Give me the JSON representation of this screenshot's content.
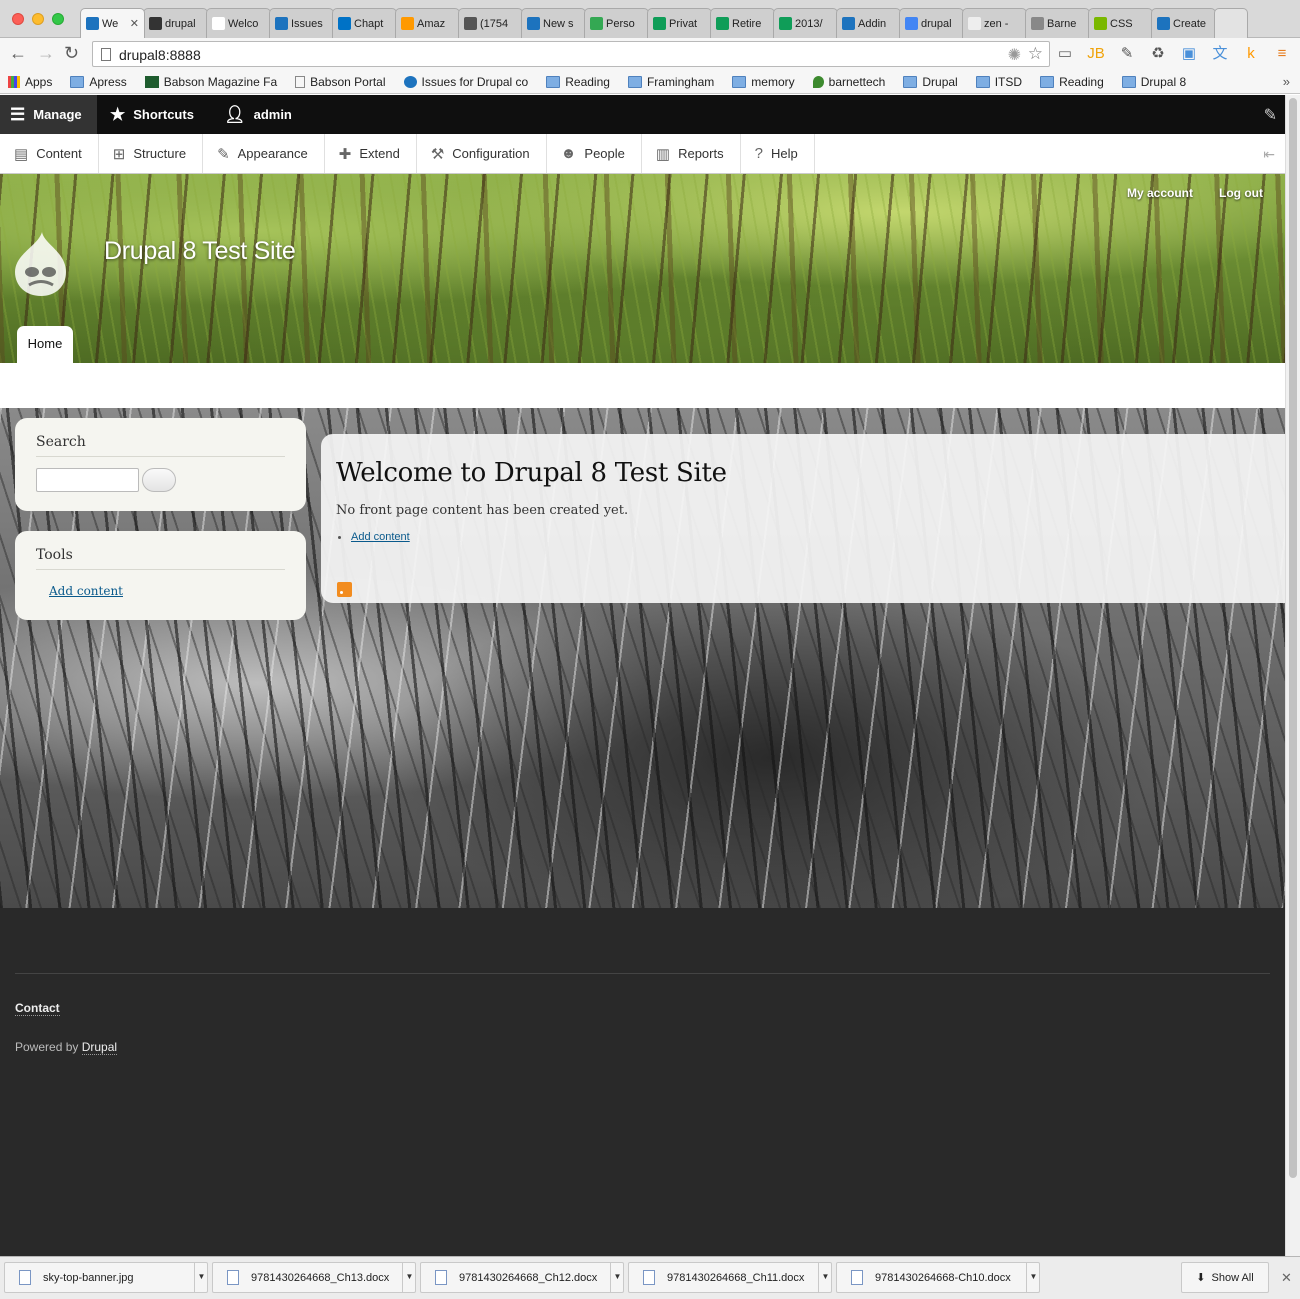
{
  "browser": {
    "tabs": [
      {
        "title": "We",
        "color": "#1d73be",
        "active": true
      },
      {
        "title": "drupal",
        "color": "#333333"
      },
      {
        "title": "Welco",
        "color": "#ffffff"
      },
      {
        "title": "Issues",
        "color": "#1d73be"
      },
      {
        "title": "Chapt",
        "color": "#0072c6"
      },
      {
        "title": "Amaz",
        "color": "#ff9900"
      },
      {
        "title": "(1754",
        "color": "#555555"
      },
      {
        "title": "New s",
        "color": "#1d73be"
      },
      {
        "title": "Perso",
        "color": "#34a853"
      },
      {
        "title": "Privat",
        "color": "#0f9d58"
      },
      {
        "title": "Retire",
        "color": "#0f9d58"
      },
      {
        "title": "2013/",
        "color": "#0f9d58"
      },
      {
        "title": "Addin",
        "color": "#1d73be"
      },
      {
        "title": "drupal",
        "color": "#4285f4"
      },
      {
        "title": "zen -",
        "color": "#eeeeee"
      },
      {
        "title": "Barne",
        "color": "#888888"
      },
      {
        "title": "CSS",
        "color": "#7ab800"
      },
      {
        "title": "Create",
        "color": "#1d73be"
      }
    ],
    "tab_close": "✕",
    "url": "drupal8:8888",
    "nav": {
      "back": "←",
      "forward": "→",
      "reload": "↻",
      "star": "☆",
      "gear": "✺"
    },
    "extensions": [
      {
        "icon": "cast-icon",
        "glyph": "▭",
        "color": "#666666"
      },
      {
        "icon": "jetbrains-icon",
        "glyph": "JB",
        "color": "#f0a30a"
      },
      {
        "icon": "eyedropper-icon",
        "glyph": "✎",
        "color": "#555555"
      },
      {
        "icon": "recycle-icon",
        "glyph": "♻",
        "color": "#555555"
      },
      {
        "icon": "window-icon",
        "glyph": "▣",
        "color": "#4a90d9"
      },
      {
        "icon": "translate-icon",
        "glyph": "文",
        "color": "#4a90d9"
      },
      {
        "icon": "k-icon",
        "glyph": "k",
        "color": "#ff9900"
      },
      {
        "icon": "menu-icon",
        "glyph": "≡",
        "color": "#e67e22"
      }
    ],
    "bookmarks": [
      {
        "label": "Apps",
        "type": "apps"
      },
      {
        "label": "Apress",
        "type": "folder"
      },
      {
        "label": "Babson Magazine Fa",
        "type": "b"
      },
      {
        "label": "Babson Portal",
        "type": "page"
      },
      {
        "label": "Issues for Drupal co",
        "type": "drupal"
      },
      {
        "label": "Reading",
        "type": "folder"
      },
      {
        "label": "Framingham",
        "type": "folder"
      },
      {
        "label": "memory",
        "type": "folder"
      },
      {
        "label": "barnettech",
        "type": "leaf"
      },
      {
        "label": "Drupal",
        "type": "folder"
      },
      {
        "label": "ITSD",
        "type": "folder"
      },
      {
        "label": "Reading",
        "type": "folder"
      },
      {
        "label": "Drupal 8",
        "type": "folder"
      }
    ],
    "bookmarks_more": "»"
  },
  "admin": {
    "manage": "Manage",
    "shortcuts": "Shortcuts",
    "user": "admin",
    "tray": [
      {
        "label": "Content",
        "icon": "content-icon",
        "glyph": "▤"
      },
      {
        "label": "Structure",
        "icon": "structure-icon",
        "glyph": "⊞"
      },
      {
        "label": "Appearance",
        "icon": "appearance-icon",
        "glyph": "✎"
      },
      {
        "label": "Extend",
        "icon": "extend-icon",
        "glyph": "✚"
      },
      {
        "label": "Configuration",
        "icon": "configuration-icon",
        "glyph": "⚒"
      },
      {
        "label": "People",
        "icon": "people-icon",
        "glyph": "☻"
      },
      {
        "label": "Reports",
        "icon": "reports-icon",
        "glyph": "▥"
      },
      {
        "label": "Help",
        "icon": "help-icon",
        "glyph": "?"
      }
    ]
  },
  "site": {
    "name": "Drupal 8 Test Site",
    "my_account": "My account",
    "log_out": "Log out",
    "home_tab": "Home"
  },
  "sidebar": {
    "search_title": "Search",
    "tools_title": "Tools",
    "tools_link": "Add content"
  },
  "main": {
    "title": "Welcome to Drupal 8 Test Site",
    "message": "No front page content has been created yet.",
    "link": "Add content"
  },
  "footer": {
    "contact": "Contact",
    "powered_prefix": "Powered by",
    "powered_link": "Drupal"
  },
  "downloads": {
    "items": [
      {
        "name": "sky-top-banner.jpg"
      },
      {
        "name": "9781430264668_Ch13.docx"
      },
      {
        "name": "9781430264668_Ch12.docx"
      },
      {
        "name": "9781430264668_Ch11.docx"
      },
      {
        "name": "9781430264668-Ch10.docx"
      }
    ],
    "show_all": "Show All",
    "close": "✕"
  }
}
